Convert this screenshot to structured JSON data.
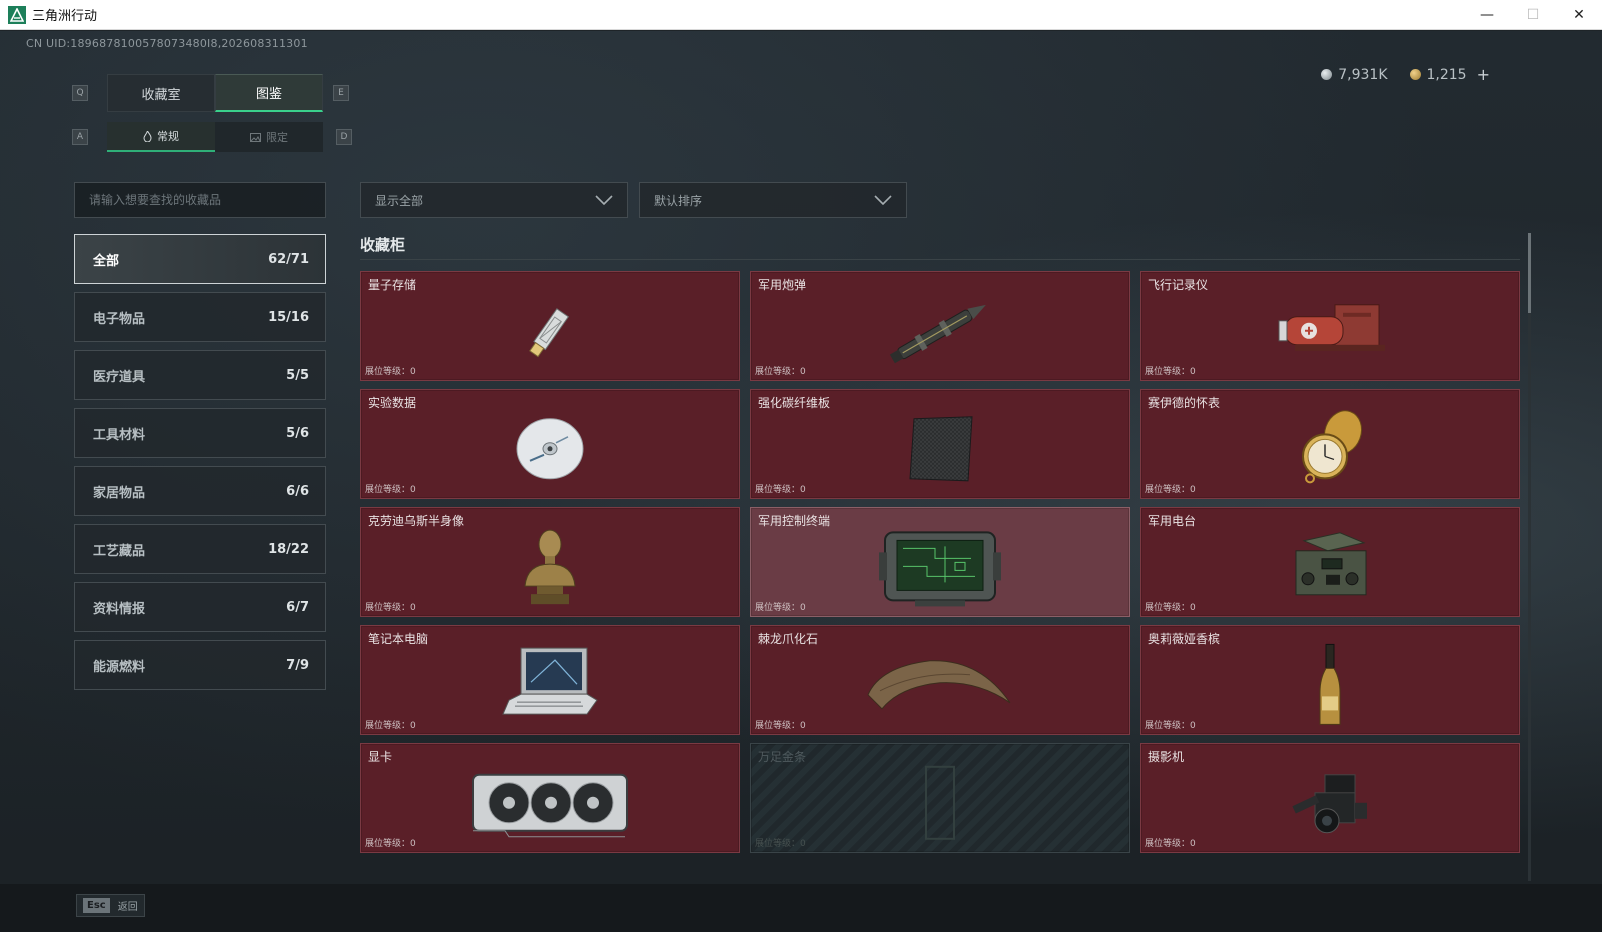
{
  "window": {
    "title": "三角洲行动",
    "minimize": "—",
    "maximize": "☐",
    "close": "✕"
  },
  "header": {
    "uid": "CN UID:1896878100578073480I8,202608311301",
    "currency": {
      "silver": "7,931K",
      "gold": "1,215",
      "plus": "+"
    }
  },
  "keys": {
    "q": "Q",
    "e": "E",
    "a": "A",
    "d": "D"
  },
  "tabs": {
    "main": [
      {
        "label": "收藏室",
        "active": false
      },
      {
        "label": "图鉴",
        "active": true
      }
    ],
    "sub": [
      {
        "label": "常规",
        "icon": "flame-icon",
        "active": true
      },
      {
        "label": "限定",
        "icon": "image-icon",
        "active": false
      }
    ]
  },
  "search": {
    "placeholder": "请输入想要查找的收藏品"
  },
  "filters": {
    "display": "显示全部",
    "sort": "默认排序"
  },
  "categories": [
    {
      "label": "全部",
      "count": "62/71",
      "active": true
    },
    {
      "label": "电子物品",
      "count": "15/16"
    },
    {
      "label": "医疗道具",
      "count": "5/5"
    },
    {
      "label": "工具材料",
      "count": "5/6"
    },
    {
      "label": "家居物品",
      "count": "6/6"
    },
    {
      "label": "工艺藏品",
      "count": "18/22"
    },
    {
      "label": "资料情报",
      "count": "6/7"
    },
    {
      "label": "能源燃料",
      "count": "7/9"
    }
  ],
  "section": {
    "title": "收藏柜"
  },
  "items": [
    {
      "name": "量子存储",
      "level": "展位等级：0",
      "icon": "usb-drive-icon"
    },
    {
      "name": "军用炮弹",
      "level": "展位等级：0",
      "icon": "artillery-shell-icon"
    },
    {
      "name": "飞行记录仪",
      "level": "展位等级：0",
      "icon": "flight-recorder-icon"
    },
    {
      "name": "实验数据",
      "level": "展位等级：0",
      "icon": "disc-icon"
    },
    {
      "name": "强化碳纤维板",
      "level": "展位等级：0",
      "icon": "carbon-plate-icon"
    },
    {
      "name": "赛伊德的怀表",
      "level": "展位等级：0",
      "icon": "pocket-watch-icon"
    },
    {
      "name": "克劳迪乌斯半身像",
      "level": "展位等级：0",
      "icon": "bust-icon"
    },
    {
      "name": "军用控制终端",
      "level": "展位等级：0",
      "icon": "control-terminal-icon"
    },
    {
      "name": "军用电台",
      "level": "展位等级：0",
      "icon": "radio-icon"
    },
    {
      "name": "笔记本电脑",
      "level": "展位等级：0",
      "icon": "laptop-icon"
    },
    {
      "name": "棘龙爪化石",
      "level": "展位等级：0",
      "icon": "claw-fossil-icon"
    },
    {
      "name": "奥莉薇娅香槟",
      "level": "展位等级：0",
      "icon": "champagne-icon"
    },
    {
      "name": "显卡",
      "level": "展位等级：0",
      "icon": "gpu-icon"
    },
    {
      "name": "万足金条",
      "level": "展位等级：0",
      "icon": "gold-bar-icon",
      "locked": true
    },
    {
      "name": "摄影机",
      "level": "展位等级：0",
      "icon": "camera-icon"
    }
  ],
  "footer": {
    "esc_key": "Esc",
    "back_label": "返回"
  }
}
